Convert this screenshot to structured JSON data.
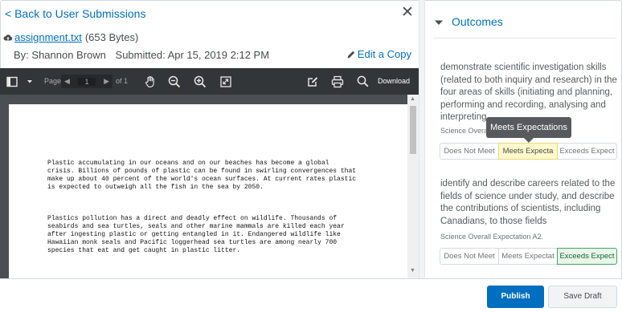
{
  "header": {
    "back_label": "< Back to User Submissions",
    "close_label": "✕"
  },
  "file": {
    "name": "assignment.txt",
    "size": "(653 Bytes)",
    "by": "By: Shannon Brown",
    "submitted": "Submitted: Apr 15, 2019 2:12 PM",
    "edit_label": "Edit a Copy"
  },
  "toolbar": {
    "page_label": "Page",
    "page_value": "1",
    "page_total": "of 1",
    "download_label": "Download"
  },
  "document": {
    "paragraphs": [
      "Plastic accumulating in our oceans and on our beaches has become a global\ncrisis. Billions of pounds of plastic can be found in swirling convergences that\nmake up about 40 percent of the world's ocean surfaces. At current rates plastic\nis expected to outweigh all the fish in the sea by 2050.",
      "Plastics pollution has a direct and deadly effect on wildlife. Thousands of\nseabirds and sea turtles, seals and other marine mammals are killed each year\nafter ingesting plastic or getting entangled in it. Endangered wildlife like\nHawaiian monk seals and Pacific loggerhead sea turtles are among nearly 700\nspecies that eat and get caught in plastic litter."
    ]
  },
  "outcomes": {
    "title": "Outcomes",
    "items": [
      {
        "text": "demonstrate scientific investigation skills (related to both inquiry and research) in the four areas of skills (initiating and planning, performing and recording, analysing and interpreting,",
        "category": "Science Overa",
        "levels": [
          "Does Not Meet",
          "Meets Expecta",
          "Exceeds Expect"
        ],
        "hovered": "Meets Expecta"
      },
      {
        "text": "identify and describe careers related to the fields of science under study, and describe the contributions of scientists, including Canadians, to those fields",
        "category": "Science Overall Expectation A2.",
        "levels": [
          "Does Not Meet",
          "Meets Expectat",
          "Exceeds Expect"
        ],
        "selected": "Exceeds Expect"
      }
    ],
    "tooltip": "Meets Expectations"
  },
  "footer": {
    "publish_label": "Publish",
    "draft_label": "Save Draft"
  },
  "colors": {
    "link": "#006fbf",
    "toolbar": "#323639",
    "viewer_bg": "#4b4f53",
    "primary": "#006fbf",
    "selected": "#46a661"
  }
}
